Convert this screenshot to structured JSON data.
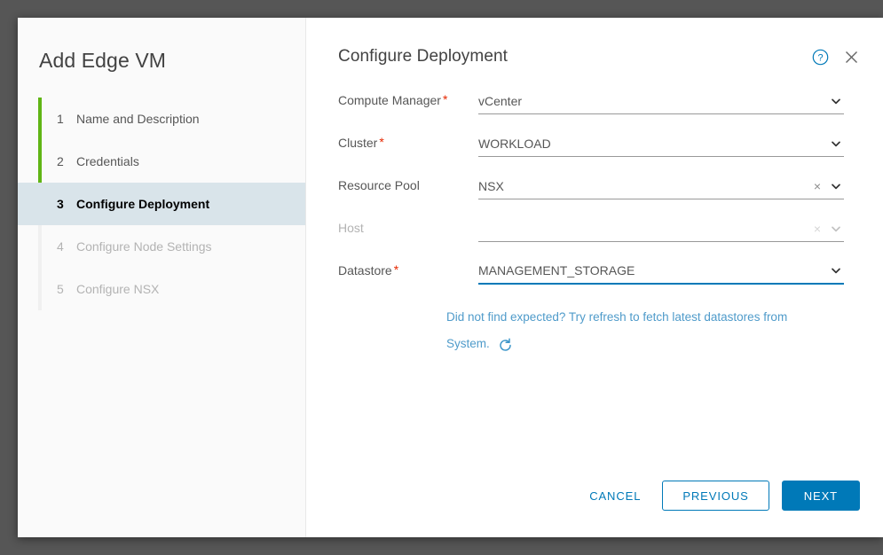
{
  "wizard": {
    "title": "Add Edge VM",
    "steps": [
      {
        "num": "1",
        "label": "Name and Description",
        "state": "done"
      },
      {
        "num": "2",
        "label": "Credentials",
        "state": "done"
      },
      {
        "num": "3",
        "label": "Configure Deployment",
        "state": "active"
      },
      {
        "num": "4",
        "label": "Configure Node Settings",
        "state": "disabled"
      },
      {
        "num": "5",
        "label": "Configure NSX",
        "state": "disabled"
      }
    ]
  },
  "panel": {
    "title": "Configure Deployment",
    "help_icon": "help-circle-icon",
    "close_icon": "close-icon"
  },
  "form": {
    "fields": [
      {
        "label": "Compute Manager",
        "required": true,
        "value": "vCenter",
        "placeholder": "",
        "disabled": false,
        "focused": false,
        "clearable": false
      },
      {
        "label": "Cluster",
        "required": true,
        "value": "WORKLOAD",
        "placeholder": "",
        "disabled": false,
        "focused": false,
        "clearable": false
      },
      {
        "label": "Resource Pool",
        "required": false,
        "value": "NSX",
        "placeholder": "",
        "disabled": false,
        "focused": false,
        "clearable": true
      },
      {
        "label": "Host",
        "required": false,
        "value": "",
        "placeholder": "",
        "disabled": true,
        "focused": false,
        "clearable": true
      },
      {
        "label": "Datastore",
        "required": true,
        "value": "MANAGEMENT_STORAGE",
        "placeholder": "",
        "disabled": false,
        "focused": true,
        "clearable": false
      }
    ],
    "hint_text": "Did not find expected? Try refresh to fetch latest datastores from System.",
    "refresh_icon": "refresh-icon"
  },
  "footer": {
    "cancel_label": "CANCEL",
    "previous_label": "PREVIOUS",
    "next_label": "NEXT"
  },
  "colors": {
    "accent": "#0079b8",
    "done_rail": "#60b515",
    "required_mark": "#e62700",
    "active_step_bg": "#d9e4ea",
    "hint": "#4f9bca",
    "backdrop": "#565656"
  }
}
